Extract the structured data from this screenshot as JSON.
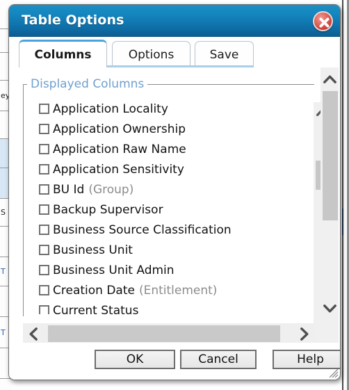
{
  "dialog": {
    "title": "Table Options",
    "close_icon": "close-circle-icon"
  },
  "tabs": [
    {
      "label": "Columns",
      "active": true
    },
    {
      "label": "Options",
      "active": false
    },
    {
      "label": "Save",
      "active": false
    }
  ],
  "fieldset": {
    "legend": "Displayed Columns"
  },
  "columns": [
    {
      "label": "Application Locality",
      "suffix": "",
      "checked": false
    },
    {
      "label": "Application Ownership",
      "suffix": "",
      "checked": false
    },
    {
      "label": "Application Raw Name",
      "suffix": "",
      "checked": false
    },
    {
      "label": "Application Sensitivity",
      "suffix": "",
      "checked": false
    },
    {
      "label": "BU Id",
      "suffix": "(Group)",
      "checked": false
    },
    {
      "label": "Backup Supervisor",
      "suffix": "",
      "checked": false
    },
    {
      "label": "Business Source Classification",
      "suffix": "",
      "checked": false
    },
    {
      "label": "Business Unit",
      "suffix": "",
      "checked": false
    },
    {
      "label": "Business Unit Admin",
      "suffix": "",
      "checked": false
    },
    {
      "label": "Creation Date",
      "suffix": "(Entitlement)",
      "checked": false
    },
    {
      "label": "Current Status",
      "suffix": "",
      "checked": false
    }
  ],
  "scrollbars": {
    "inner_vertical": {
      "up_icon": "chevron-up-icon",
      "down_icon": "chevron-down-icon"
    },
    "outer_vertical": {
      "up_icon": "chevron-up-icon",
      "down_icon": "chevron-down-icon"
    },
    "horizontal": {
      "left_icon": "chevron-left-icon",
      "right_icon": "chevron-right-icon"
    }
  },
  "buttons": {
    "ok": "OK",
    "cancel": "Cancel",
    "help": "Help"
  },
  "colors": {
    "title_bar_top": "#1e8ec4",
    "title_bar_bottom": "#0b5e93",
    "close_button": "#c83a31",
    "legend_text": "#6f9fd0",
    "active_tab_border": "#4aa3df",
    "suffix_text": "#8c8c8c",
    "scroll_thumb": "#c7c7c7"
  }
}
